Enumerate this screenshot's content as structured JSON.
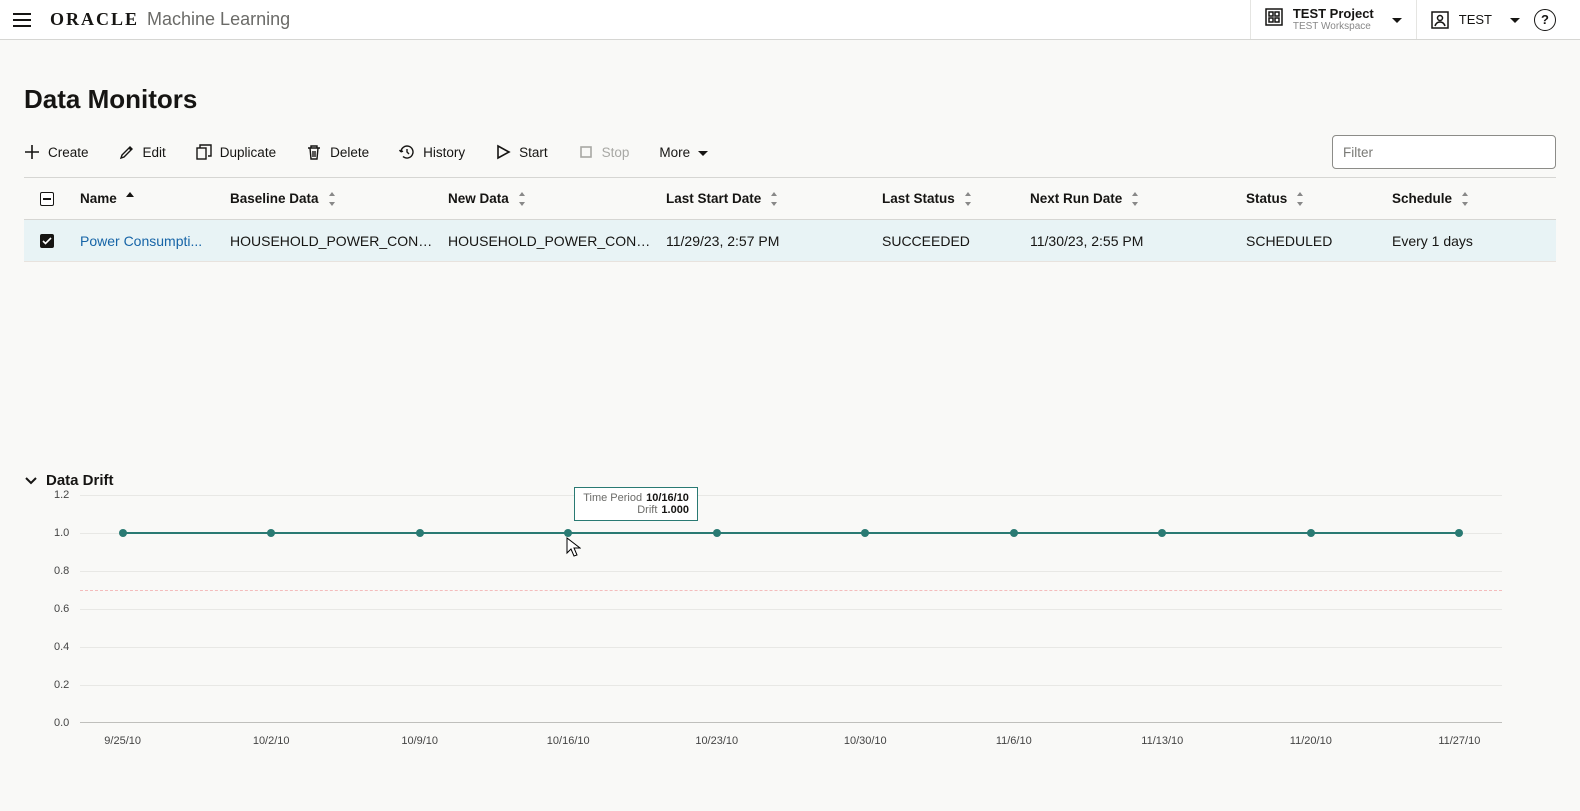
{
  "header": {
    "brand": "ORACLE",
    "product": "Machine Learning",
    "project_name": "TEST Project",
    "workspace": "TEST Workspace",
    "user": "TEST"
  },
  "page": {
    "title": "Data Monitors"
  },
  "toolbar": {
    "create": "Create",
    "edit": "Edit",
    "duplicate": "Duplicate",
    "delete": "Delete",
    "history": "History",
    "start": "Start",
    "stop": "Stop",
    "more": "More",
    "filter_placeholder": "Filter"
  },
  "columns": {
    "name": "Name",
    "baseline": "Baseline Data",
    "newdata": "New Data",
    "last_start": "Last Start Date",
    "last_status": "Last Status",
    "next_run": "Next Run Date",
    "status": "Status",
    "schedule": "Schedule"
  },
  "row": {
    "name": "Power Consumpti...",
    "baseline": "HOUSEHOLD_POWER_CONS...",
    "newdata": "HOUSEHOLD_POWER_CONS...",
    "last_start": "11/29/23, 2:57 PM",
    "last_status": "SUCCEEDED",
    "next_run": "11/30/23, 2:55 PM",
    "status": "SCHEDULED",
    "schedule": "Every 1 days"
  },
  "drift": {
    "title": "Data Drift",
    "tooltip": {
      "label_period": "Time Period",
      "value_period": "10/16/10",
      "label_drift": "Drift",
      "value_drift": "1.000"
    }
  },
  "chart_data": {
    "type": "line",
    "title": "Data Drift",
    "xlabel": "",
    "ylabel": "",
    "ylim": [
      0.0,
      1.2
    ],
    "y_ticks": [
      0.0,
      0.2,
      0.4,
      0.6,
      0.8,
      1.0,
      1.2
    ],
    "threshold": 0.7,
    "categories": [
      "9/25/10",
      "10/2/10",
      "10/9/10",
      "10/16/10",
      "10/23/10",
      "10/30/10",
      "11/6/10",
      "11/13/10",
      "11/20/10",
      "11/27/10"
    ],
    "series": [
      {
        "name": "Drift",
        "values": [
          1.0,
          1.0,
          1.0,
          1.0,
          1.0,
          1.0,
          1.0,
          1.0,
          1.0,
          1.0
        ]
      }
    ],
    "highlighted_index": 3
  }
}
